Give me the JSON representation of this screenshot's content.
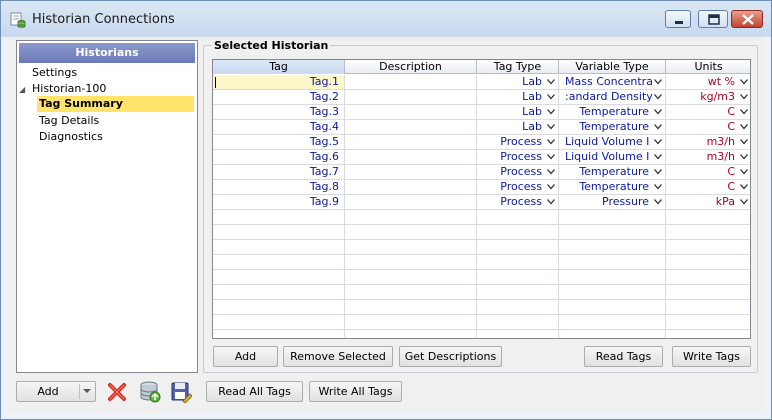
{
  "window": {
    "title": "Historian Connections"
  },
  "tree": {
    "header": "Historians",
    "items": [
      {
        "label": "Settings"
      },
      {
        "label": "Historian-100"
      },
      {
        "label": "Tag Summary"
      },
      {
        "label": "Tag Details"
      },
      {
        "label": "Diagnostics"
      }
    ]
  },
  "group": {
    "title": "Selected Historian"
  },
  "grid": {
    "columns": [
      "Tag",
      "Description",
      "Tag Type",
      "Variable Type",
      "Units"
    ],
    "rows": [
      {
        "tag": "Tag.1",
        "description": "",
        "tag_type": "Lab",
        "variable_type": "Mass Concentra",
        "units": "wt %"
      },
      {
        "tag": "Tag.2",
        "description": "",
        "tag_type": "Lab",
        "variable_type": ":andard Density",
        "units": "kg/m3"
      },
      {
        "tag": "Tag.3",
        "description": "",
        "tag_type": "Lab",
        "variable_type": "Temperature",
        "units": "C"
      },
      {
        "tag": "Tag.4",
        "description": "",
        "tag_type": "Lab",
        "variable_type": "Temperature",
        "units": "C"
      },
      {
        "tag": "Tag.5",
        "description": "",
        "tag_type": "Process",
        "variable_type": "Liquid Volume I",
        "units": "m3/h"
      },
      {
        "tag": "Tag.6",
        "description": "",
        "tag_type": "Process",
        "variable_type": "Liquid Volume I",
        "units": "m3/h"
      },
      {
        "tag": "Tag.7",
        "description": "",
        "tag_type": "Process",
        "variable_type": "Temperature",
        "units": "C"
      },
      {
        "tag": "Tag.8",
        "description": "",
        "tag_type": "Process",
        "variable_type": "Temperature",
        "units": "C"
      },
      {
        "tag": "Tag.9",
        "description": "",
        "tag_type": "Process",
        "variable_type": "Pressure",
        "units": "kPa"
      }
    ]
  },
  "buttons": {
    "add": "Add",
    "remove_selected": "Remove Selected",
    "get_descriptions": "Get Descriptions",
    "read_tags": "Read Tags",
    "write_tags": "Write Tags",
    "add_historian": "Add",
    "read_all_tags": "Read All Tags",
    "write_all_tags": "Write All Tags"
  },
  "icons": {
    "app": "historian-app-icon",
    "delete": "red-x-delete-icon",
    "database": "database-refresh-icon",
    "save": "save-disk-icon"
  },
  "colors": {
    "tag_text": "#0b1a9e",
    "units_text": "#b00020",
    "tree_header": "#7885c2",
    "selection": "#ffe36b"
  }
}
